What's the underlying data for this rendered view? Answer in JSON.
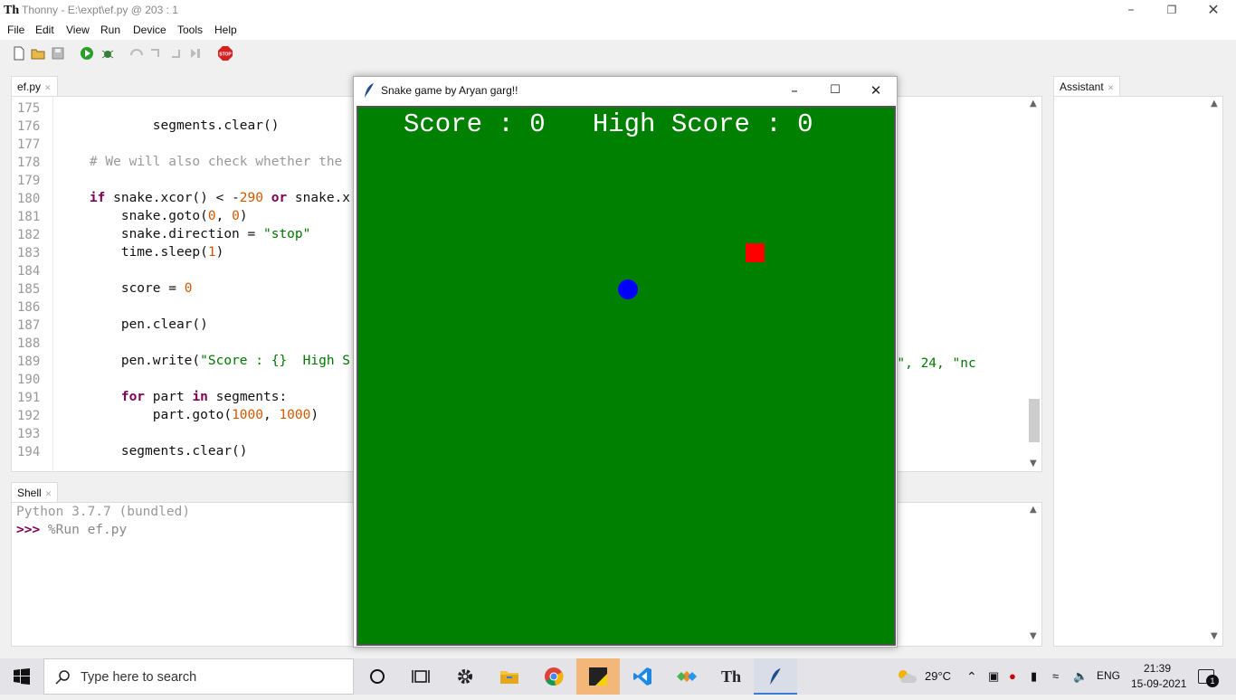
{
  "app": {
    "logo": "Th",
    "title": "Thonny  -  E:\\expt\\ef.py  @  203 : 1"
  },
  "menu": [
    "File",
    "Edit",
    "View",
    "Run",
    "Device",
    "Tools",
    "Help"
  ],
  "toolbar": {
    "icons": [
      "new-file-icon",
      "open-file-icon",
      "save-icon",
      "run-icon",
      "debug-icon",
      "step-over-icon",
      "step-into-icon",
      "step-out-icon",
      "resume-icon",
      "stop-icon"
    ],
    "stop_label": "STOP"
  },
  "editor": {
    "tab_label": "ef.py",
    "lines": [
      {
        "n": "175",
        "html": ""
      },
      {
        "n": "176",
        "html": "            segments.clear()"
      },
      {
        "n": "177",
        "html": ""
      },
      {
        "n": "178",
        "html": "    <span class=\"cm\"># We will also check whether the</span>"
      },
      {
        "n": "179",
        "html": ""
      },
      {
        "n": "180",
        "html": "    <span class=\"kw\">if</span> snake.xcor() &lt; -<span class=\"num\">290</span> <span class=\"kw\">or</span> snake.x"
      },
      {
        "n": "181",
        "html": "        snake.goto(<span class=\"num\">0</span>, <span class=\"num\">0</span>)"
      },
      {
        "n": "182",
        "html": "        snake.direction = <span class=\"str\">\"stop\"</span>"
      },
      {
        "n": "183",
        "html": "        time.sleep(<span class=\"num\">1</span>)"
      },
      {
        "n": "184",
        "html": ""
      },
      {
        "n": "185",
        "html": "        score = <span class=\"num\">0</span>"
      },
      {
        "n": "186",
        "html": ""
      },
      {
        "n": "187",
        "html": "        pen.clear()"
      },
      {
        "n": "188",
        "html": ""
      },
      {
        "n": "189",
        "html": "        pen.write(<span class=\"str\">\"Score : {}  High S</span>"
      },
      {
        "n": "190",
        "html": ""
      },
      {
        "n": "191",
        "html": "        <span class=\"kw\">for</span> part <span class=\"kw\">in</span> segments:"
      },
      {
        "n": "192",
        "html": "            part.goto(<span class=\"num\">1000</span>, <span class=\"num\">1000</span>)"
      },
      {
        "n": "193",
        "html": ""
      },
      {
        "n": "194",
        "html": "        segments.clear()"
      }
    ],
    "line_189_tail": "ourier\", 24, \"nc"
  },
  "shell": {
    "tab_label": "Shell",
    "banner": "Python 3.7.7 (bundled)",
    "prompt": ">>>",
    "command": " %Run ef.py"
  },
  "assistant": {
    "tab_label": "Assistant"
  },
  "turtle_window": {
    "title": "Snake game by Aryan garg!!",
    "score_text": "Score : 0   High Score : 0",
    "canvas_color": "#008000",
    "food_color": "#ff0000",
    "snake_color": "#0000ff"
  },
  "taskbar": {
    "search_placeholder": "Type here to search",
    "weather": "29°C",
    "language": "ENG",
    "time": "21:39",
    "date": "15-09-2021",
    "notification_count": "1"
  }
}
